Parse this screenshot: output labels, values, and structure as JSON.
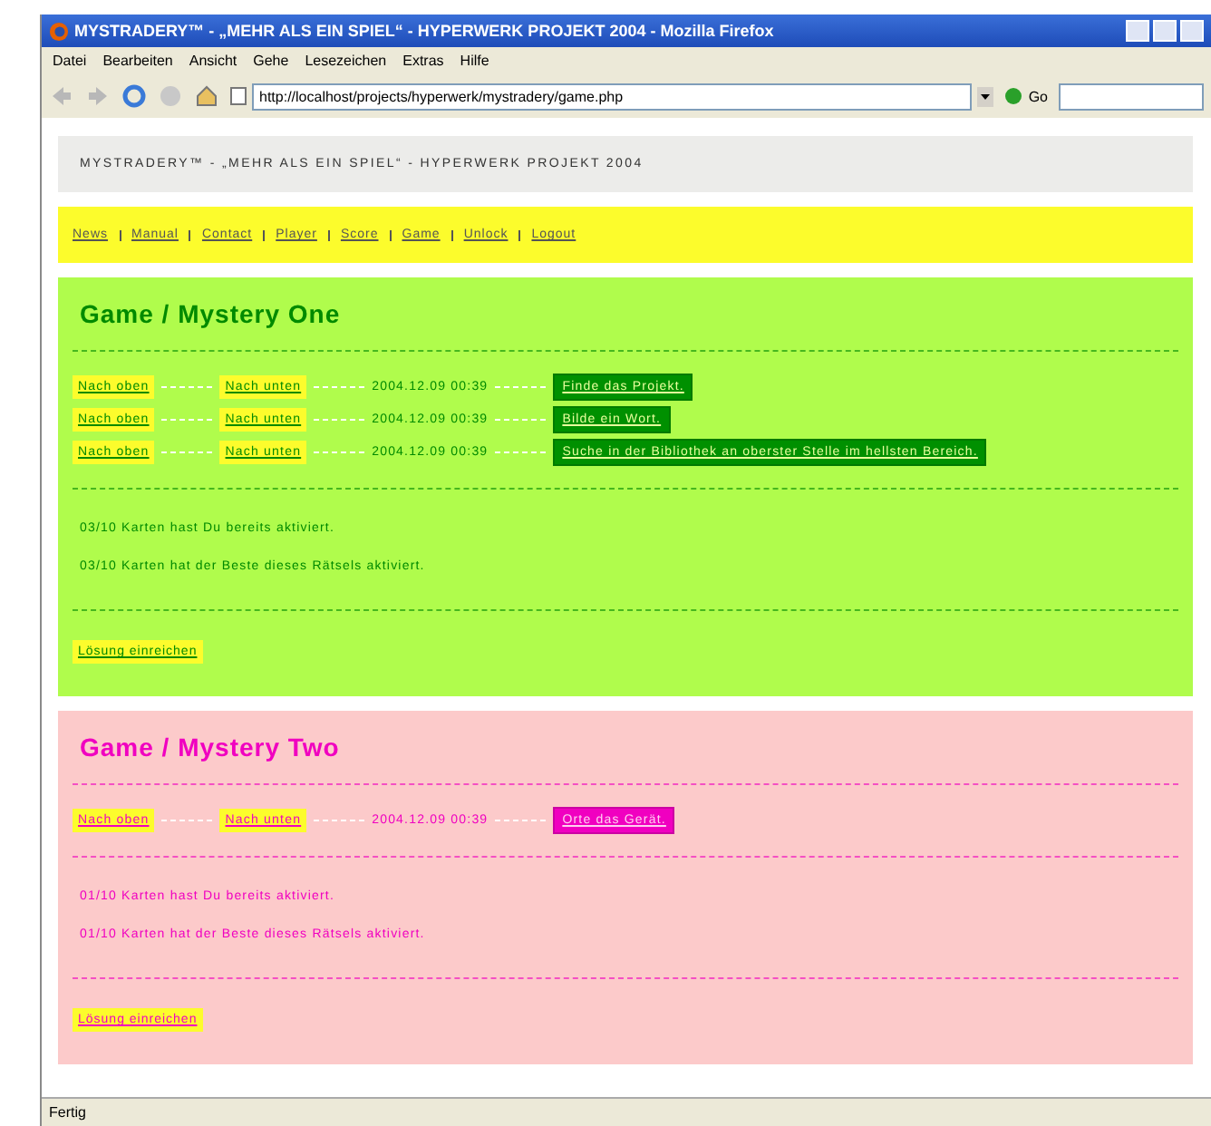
{
  "window": {
    "title": "MYSTRADERY™ - „MEHR ALS EIN SPIEL“ - HYPERWERK PROJEKT 2004 - Mozilla Firefox"
  },
  "menu": [
    "Datei",
    "Bearbeiten",
    "Ansicht",
    "Gehe",
    "Lesezeichen",
    "Extras",
    "Hilfe"
  ],
  "address_bar": {
    "value": "http://localhost/projects/hyperwerk/mystradery/game.php"
  },
  "go_button": "Go",
  "site_header": "MYSTRADERY™ - „MEHR ALS EIN SPIEL“ - HYPERWERK PROJEKT 2004",
  "nav": [
    "News",
    "Manual",
    "Contact",
    "Player",
    "Score",
    "Game",
    "Unlock",
    "Logout"
  ],
  "sections": [
    {
      "kind": "green",
      "title": "Game / Mystery One",
      "entries": [
        {
          "up": "Nach oben",
          "down": "Nach unten",
          "time": "2004.12.09 00:39",
          "clue": "Finde das Projekt."
        },
        {
          "up": "Nach oben",
          "down": "Nach unten",
          "time": "2004.12.09 00:39",
          "clue": "Bilde ein Wort."
        },
        {
          "up": "Nach oben",
          "down": "Nach unten",
          "time": "2004.12.09 00:39",
          "clue": "Suche in der Bibliothek an oberster Stelle im hellsten Bereich."
        }
      ],
      "stats": [
        "03/10 Karten hast Du bereits aktiviert.",
        "03/10 Karten hat der Beste dieses Rätsels aktiviert."
      ],
      "submit": "Lösung einreichen"
    },
    {
      "kind": "pink",
      "title": "Game / Mystery Two",
      "entries": [
        {
          "up": "Nach oben",
          "down": "Nach unten",
          "time": "2004.12.09 00:39",
          "clue": "Orte das Gerät."
        }
      ],
      "stats": [
        "01/10 Karten hast Du bereits aktiviert.",
        "01/10 Karten hat der Beste dieses Rätsels aktiviert."
      ],
      "submit": "Lösung einreichen"
    }
  ],
  "status_bar": "Fertig"
}
